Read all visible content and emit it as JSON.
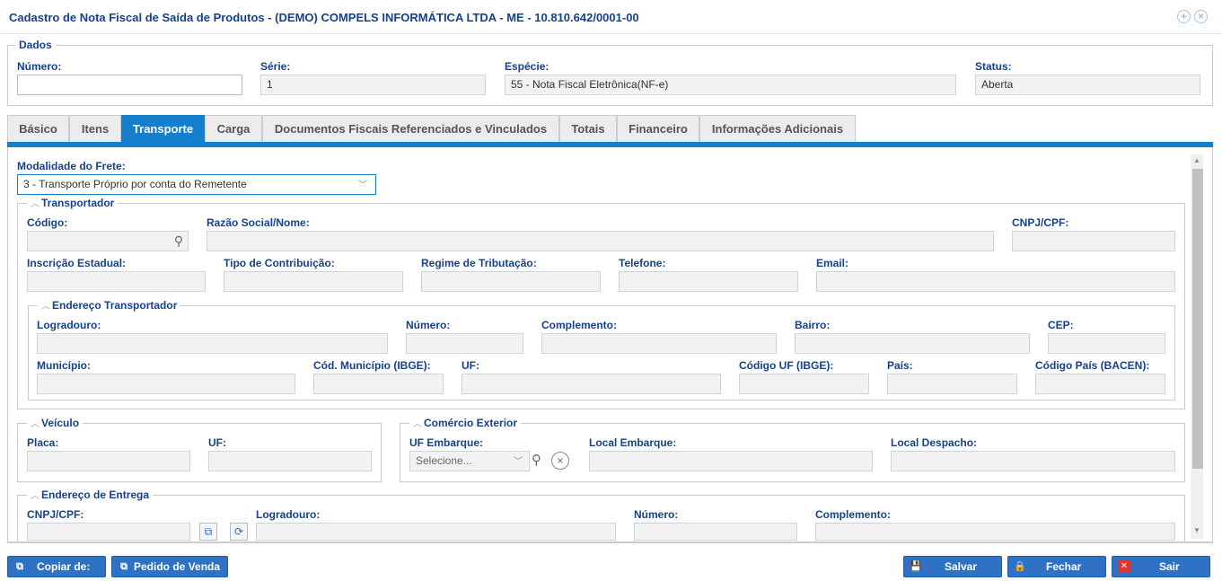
{
  "window": {
    "title": "Cadastro de Nota Fiscal de Saída de Produtos - (DEMO) COMPELS INFORMÁTICA LTDA - ME - 10.810.642/0001-00",
    "icons": [
      "expand-icon",
      "close-icon"
    ]
  },
  "dados": {
    "legend": "Dados",
    "numero_label": "Número:",
    "numero_value": "",
    "serie_label": "Série:",
    "serie_value": "1",
    "especie_label": "Espécie:",
    "especie_value": "55 - Nota Fiscal Eletrônica(NF-e)",
    "status_label": "Status:",
    "status_value": "Aberta"
  },
  "tabs": [
    {
      "label": "Básico",
      "active": false
    },
    {
      "label": "Itens",
      "active": false
    },
    {
      "label": "Transporte",
      "active": true
    },
    {
      "label": "Carga",
      "active": false
    },
    {
      "label": "Documentos Fiscais Referenciados e Vinculados",
      "active": false
    },
    {
      "label": "Totais",
      "active": false
    },
    {
      "label": "Financeiro",
      "active": false
    },
    {
      "label": "Informações Adicionais",
      "active": false
    }
  ],
  "transporte": {
    "modalidade_label": "Modalidade do Frete:",
    "modalidade_value": "3 - Transporte Próprio por conta do Remetente",
    "transportador": {
      "legend": "Transportador",
      "codigo_label": "Código:",
      "razao_label": "Razão Social/Nome:",
      "cnpj_label": "CNPJ/CPF:",
      "ie_label": "Inscrição Estadual:",
      "tipo_contrib_label": "Tipo de Contribuição:",
      "regime_label": "Regime de Tributação:",
      "telefone_label": "Telefone:",
      "email_label": "Email:"
    },
    "endereco_transportador": {
      "legend": "Endereço Transportador",
      "logradouro_label": "Logradouro:",
      "numero_label": "Número:",
      "complemento_label": "Complemento:",
      "bairro_label": "Bairro:",
      "cep_label": "CEP:",
      "municipio_label": "Município:",
      "cod_municipio_label": "Cód. Município (IBGE):",
      "uf_label": "UF:",
      "codigo_uf_label": "Código UF (IBGE):",
      "pais_label": "País:",
      "codigo_pais_label": "Código País (BACEN):"
    },
    "veiculo": {
      "legend": "Veículo",
      "placa_label": "Placa:",
      "uf_label": "UF:"
    },
    "comercio_exterior": {
      "legend": "Comércio Exterior",
      "uf_embarque_label": "UF Embarque:",
      "uf_embarque_placeholder": "Selecione...",
      "local_embarque_label": "Local Embarque:",
      "local_despacho_label": "Local Despacho:"
    },
    "endereco_entrega": {
      "legend": "Endereço de Entrega",
      "cnpj_label": "CNPJ/CPF:",
      "logradouro_label": "Logradouro:",
      "numero_label": "Número:",
      "complemento_label": "Complemento:"
    }
  },
  "footer": {
    "copiar_label": "Copiar de:",
    "pedido_label": "Pedido de Venda",
    "salvar_label": "Salvar",
    "fechar_label": "Fechar",
    "sair_label": "Sair"
  },
  "colors": {
    "accent": "#157fcc",
    "label": "#15428b",
    "button": "#2f72c5"
  }
}
